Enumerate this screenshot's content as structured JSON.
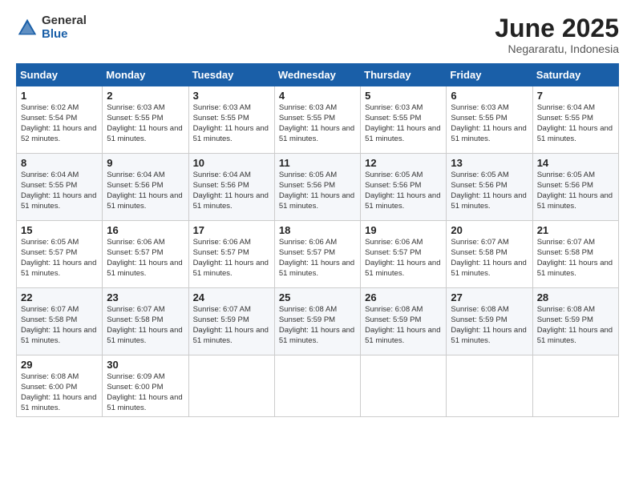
{
  "header": {
    "logo_general": "General",
    "logo_blue": "Blue",
    "month_title": "June 2025",
    "location": "Negararatu, Indonesia"
  },
  "days_of_week": [
    "Sunday",
    "Monday",
    "Tuesday",
    "Wednesday",
    "Thursday",
    "Friday",
    "Saturday"
  ],
  "weeks": [
    [
      {
        "day": "1",
        "sunrise": "6:02 AM",
        "sunset": "5:54 PM",
        "daylight": "11 hours and 52 minutes."
      },
      {
        "day": "2",
        "sunrise": "6:03 AM",
        "sunset": "5:55 PM",
        "daylight": "11 hours and 51 minutes."
      },
      {
        "day": "3",
        "sunrise": "6:03 AM",
        "sunset": "5:55 PM",
        "daylight": "11 hours and 51 minutes."
      },
      {
        "day": "4",
        "sunrise": "6:03 AM",
        "sunset": "5:55 PM",
        "daylight": "11 hours and 51 minutes."
      },
      {
        "day": "5",
        "sunrise": "6:03 AM",
        "sunset": "5:55 PM",
        "daylight": "11 hours and 51 minutes."
      },
      {
        "day": "6",
        "sunrise": "6:03 AM",
        "sunset": "5:55 PM",
        "daylight": "11 hours and 51 minutes."
      },
      {
        "day": "7",
        "sunrise": "6:04 AM",
        "sunset": "5:55 PM",
        "daylight": "11 hours and 51 minutes."
      }
    ],
    [
      {
        "day": "8",
        "sunrise": "6:04 AM",
        "sunset": "5:55 PM",
        "daylight": "11 hours and 51 minutes."
      },
      {
        "day": "9",
        "sunrise": "6:04 AM",
        "sunset": "5:56 PM",
        "daylight": "11 hours and 51 minutes."
      },
      {
        "day": "10",
        "sunrise": "6:04 AM",
        "sunset": "5:56 PM",
        "daylight": "11 hours and 51 minutes."
      },
      {
        "day": "11",
        "sunrise": "6:05 AM",
        "sunset": "5:56 PM",
        "daylight": "11 hours and 51 minutes."
      },
      {
        "day": "12",
        "sunrise": "6:05 AM",
        "sunset": "5:56 PM",
        "daylight": "11 hours and 51 minutes."
      },
      {
        "day": "13",
        "sunrise": "6:05 AM",
        "sunset": "5:56 PM",
        "daylight": "11 hours and 51 minutes."
      },
      {
        "day": "14",
        "sunrise": "6:05 AM",
        "sunset": "5:56 PM",
        "daylight": "11 hours and 51 minutes."
      }
    ],
    [
      {
        "day": "15",
        "sunrise": "6:05 AM",
        "sunset": "5:57 PM",
        "daylight": "11 hours and 51 minutes."
      },
      {
        "day": "16",
        "sunrise": "6:06 AM",
        "sunset": "5:57 PM",
        "daylight": "11 hours and 51 minutes."
      },
      {
        "day": "17",
        "sunrise": "6:06 AM",
        "sunset": "5:57 PM",
        "daylight": "11 hours and 51 minutes."
      },
      {
        "day": "18",
        "sunrise": "6:06 AM",
        "sunset": "5:57 PM",
        "daylight": "11 hours and 51 minutes."
      },
      {
        "day": "19",
        "sunrise": "6:06 AM",
        "sunset": "5:57 PM",
        "daylight": "11 hours and 51 minutes."
      },
      {
        "day": "20",
        "sunrise": "6:07 AM",
        "sunset": "5:58 PM",
        "daylight": "11 hours and 51 minutes."
      },
      {
        "day": "21",
        "sunrise": "6:07 AM",
        "sunset": "5:58 PM",
        "daylight": "11 hours and 51 minutes."
      }
    ],
    [
      {
        "day": "22",
        "sunrise": "6:07 AM",
        "sunset": "5:58 PM",
        "daylight": "11 hours and 51 minutes."
      },
      {
        "day": "23",
        "sunrise": "6:07 AM",
        "sunset": "5:58 PM",
        "daylight": "11 hours and 51 minutes."
      },
      {
        "day": "24",
        "sunrise": "6:07 AM",
        "sunset": "5:59 PM",
        "daylight": "11 hours and 51 minutes."
      },
      {
        "day": "25",
        "sunrise": "6:08 AM",
        "sunset": "5:59 PM",
        "daylight": "11 hours and 51 minutes."
      },
      {
        "day": "26",
        "sunrise": "6:08 AM",
        "sunset": "5:59 PM",
        "daylight": "11 hours and 51 minutes."
      },
      {
        "day": "27",
        "sunrise": "6:08 AM",
        "sunset": "5:59 PM",
        "daylight": "11 hours and 51 minutes."
      },
      {
        "day": "28",
        "sunrise": "6:08 AM",
        "sunset": "5:59 PM",
        "daylight": "11 hours and 51 minutes."
      }
    ],
    [
      {
        "day": "29",
        "sunrise": "6:08 AM",
        "sunset": "6:00 PM",
        "daylight": "11 hours and 51 minutes."
      },
      {
        "day": "30",
        "sunrise": "6:09 AM",
        "sunset": "6:00 PM",
        "daylight": "11 hours and 51 minutes."
      },
      {
        "day": "",
        "sunrise": "",
        "sunset": "",
        "daylight": ""
      },
      {
        "day": "",
        "sunrise": "",
        "sunset": "",
        "daylight": ""
      },
      {
        "day": "",
        "sunrise": "",
        "sunset": "",
        "daylight": ""
      },
      {
        "day": "",
        "sunrise": "",
        "sunset": "",
        "daylight": ""
      },
      {
        "day": "",
        "sunrise": "",
        "sunset": "",
        "daylight": ""
      }
    ]
  ]
}
